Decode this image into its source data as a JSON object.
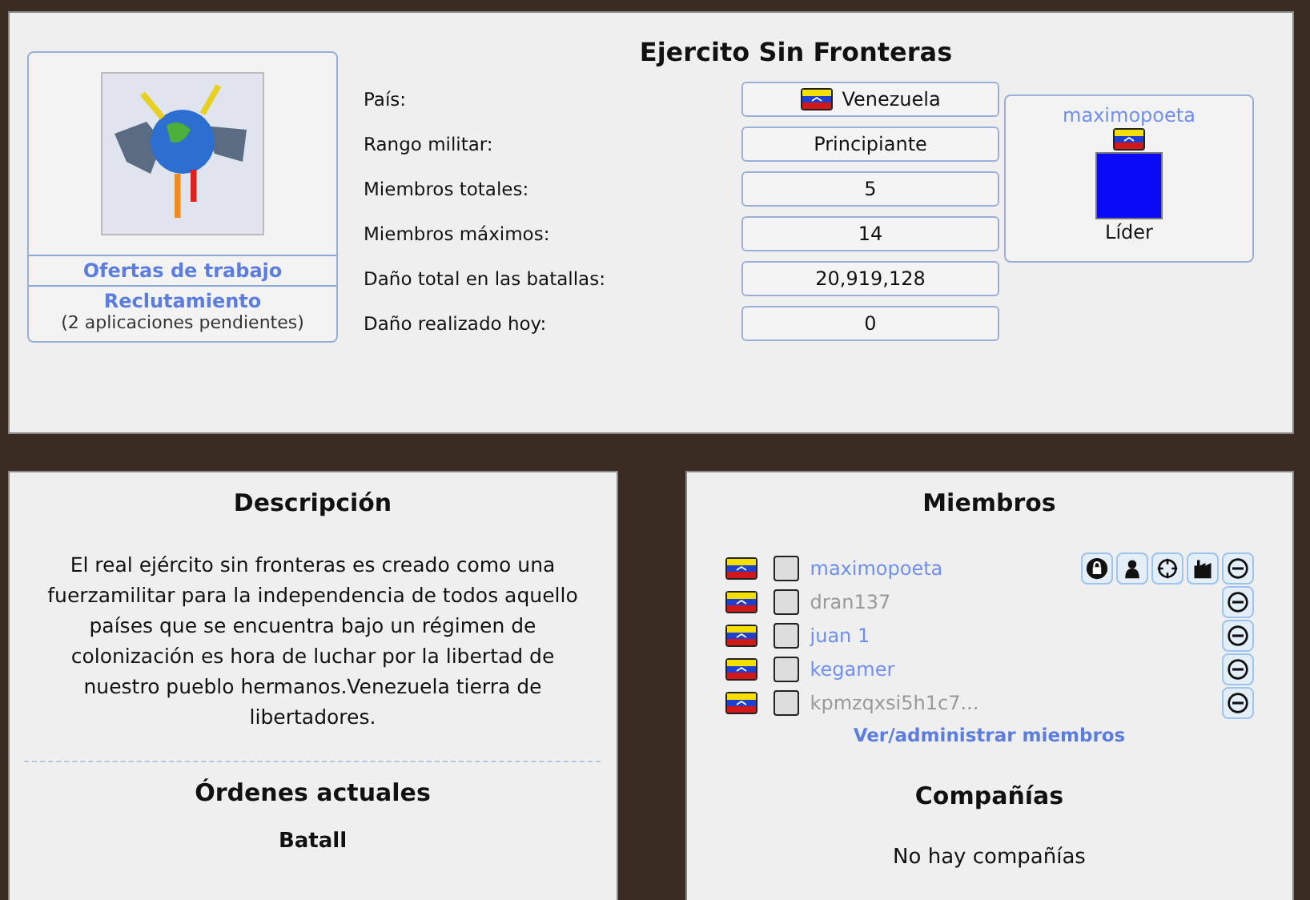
{
  "unit": {
    "title": "Ejercito Sin Fronteras",
    "links": [
      {
        "label": "Ofertas de trabajo"
      },
      {
        "label": "Reclutamiento",
        "note": "(2 aplicaciones pendientes)"
      }
    ],
    "stats": [
      {
        "label": "País:",
        "value": "Venezuela",
        "kind": "country"
      },
      {
        "label": "Rango militar:",
        "value": "Principiante",
        "kind": "text"
      },
      {
        "label": "Miembros totales:",
        "value": "5",
        "kind": "text"
      },
      {
        "label": "Miembros máximos:",
        "value": "14",
        "kind": "text"
      },
      {
        "label": "Daño total en las batallas:",
        "value": "20,919,128",
        "kind": "text"
      },
      {
        "label": "Daño realizado hoy:",
        "value": "0",
        "kind": "text"
      }
    ],
    "leader": {
      "name": "maximopoeta",
      "role": "Líder"
    }
  },
  "description": {
    "title": "Descripción",
    "text": "El real ejército sin fronteras es creado como una fuerzamilitar para la independencia de todos aquello países que se encuentra bajo un régimen de colonización es hora de luchar por la libertad de nuestro pueblo hermanos.Venezuela tierra de libertadores."
  },
  "orders": {
    "title": "Órdenes actuales",
    "subtitle": "Batall"
  },
  "members": {
    "title": "Miembros",
    "items": [
      {
        "name": "maximopoeta",
        "active": true,
        "actions": [
          {
            "kind": "lock"
          },
          {
            "kind": "person"
          },
          {
            "kind": "crosshair"
          },
          {
            "kind": "factory"
          },
          {
            "kind": "remove"
          }
        ]
      },
      {
        "name": "dran137",
        "active": false,
        "actions": [
          {
            "kind": "remove"
          }
        ]
      },
      {
        "name": "juan 1",
        "active": true,
        "actions": [
          {
            "kind": "remove"
          }
        ]
      },
      {
        "name": "kegamer",
        "active": true,
        "actions": [
          {
            "kind": "remove"
          }
        ]
      },
      {
        "name": "kpmzqxsi5h1c7...",
        "active": false,
        "actions": [
          {
            "kind": "remove"
          }
        ]
      }
    ],
    "manage_link": "Ver/administrar miembros"
  },
  "companies": {
    "title": "Compañías",
    "empty_text": "No hay compañías"
  }
}
